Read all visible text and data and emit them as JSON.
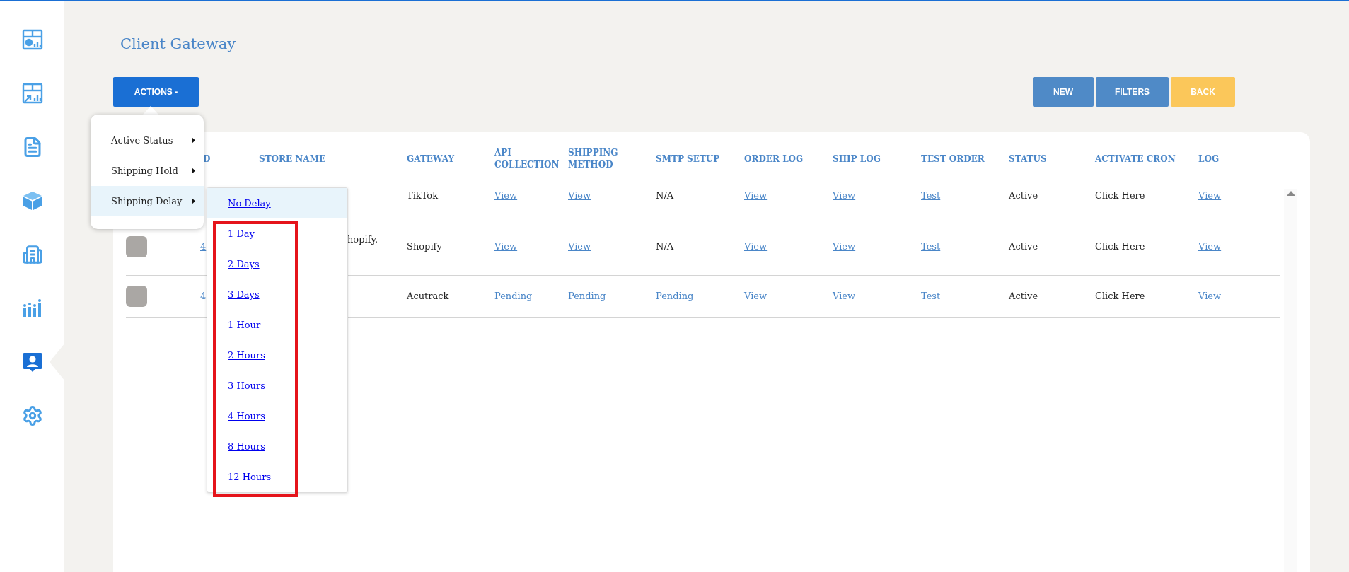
{
  "sidebar": {
    "items": [
      {
        "kind": "dashboard",
        "selected": false
      },
      {
        "kind": "report",
        "selected": false
      },
      {
        "kind": "document",
        "selected": false
      },
      {
        "kind": "box",
        "selected": false
      },
      {
        "kind": "building",
        "selected": false
      },
      {
        "kind": "chart",
        "selected": false
      },
      {
        "kind": "contact",
        "selected": true
      },
      {
        "kind": "settings",
        "selected": false
      }
    ]
  },
  "page_title": "Client Gateway",
  "actions_button": "ACTIONS -",
  "toolbar_buttons": [
    {
      "label": "NEW",
      "kind": "primary"
    },
    {
      "label": "FILTERS",
      "kind": "primary"
    },
    {
      "label": "BACK",
      "kind": "warning"
    }
  ],
  "table": {
    "columns": [
      "",
      "D",
      "STORE NAME",
      "GATEWAY",
      "API COLLECTION",
      "SHIPPING METHOD",
      "SMTP SETUP",
      "ORDER LOG",
      "SHIP LOG",
      "TEST ORDER",
      "STATUS",
      "ACTIVATE CRON",
      "LOG"
    ],
    "rows": [
      {
        "gateway": "TikTok",
        "api_collection": "View",
        "shipping_method": "View",
        "smtp_setup": {
          "text": "N/A",
          "link": false
        },
        "order_log": "View",
        "ship_log": "View",
        "test_order": "Test",
        "status": "Active",
        "activate_cron": "Click Here",
        "log": "View"
      },
      {
        "checked": false,
        "id": "4",
        "store_name": "hopify.",
        "gateway": "Shopify",
        "api_collection": "View",
        "shipping_method": "View",
        "smtp_setup": {
          "text": "N/A",
          "link": false
        },
        "order_log": "View",
        "ship_log": "View",
        "test_order": "Test",
        "status": "Active",
        "activate_cron": "Click Here",
        "log": "View"
      },
      {
        "checked": false,
        "id": "4",
        "gateway": "Acutrack",
        "api_collection": "Pending",
        "shipping_method": "Pending",
        "smtp_setup": {
          "text": "Pending",
          "link": true
        },
        "order_log": "View",
        "ship_log": "View",
        "test_order": "Test",
        "status": "Active",
        "activate_cron": "Click Here",
        "log": "View"
      }
    ]
  },
  "actions_menu": {
    "items": [
      {
        "label": "Active Status",
        "selected": false
      },
      {
        "label": "Shipping Hold",
        "selected": false
      },
      {
        "label": "Shipping Delay",
        "selected": true
      }
    ]
  },
  "delay_submenu": {
    "items": [
      {
        "label": "No Delay",
        "selected": true
      },
      {
        "label": "1 Day",
        "selected": false
      },
      {
        "label": "2 Days",
        "selected": false
      },
      {
        "label": "3 Days",
        "selected": false
      },
      {
        "label": "1 Hour",
        "selected": false
      },
      {
        "label": "2 Hours",
        "selected": false
      },
      {
        "label": "3 Hours",
        "selected": false
      },
      {
        "label": "4 Hours",
        "selected": false
      },
      {
        "label": "8 Hours",
        "selected": false
      },
      {
        "label": "12 Hours",
        "selected": false
      }
    ]
  }
}
